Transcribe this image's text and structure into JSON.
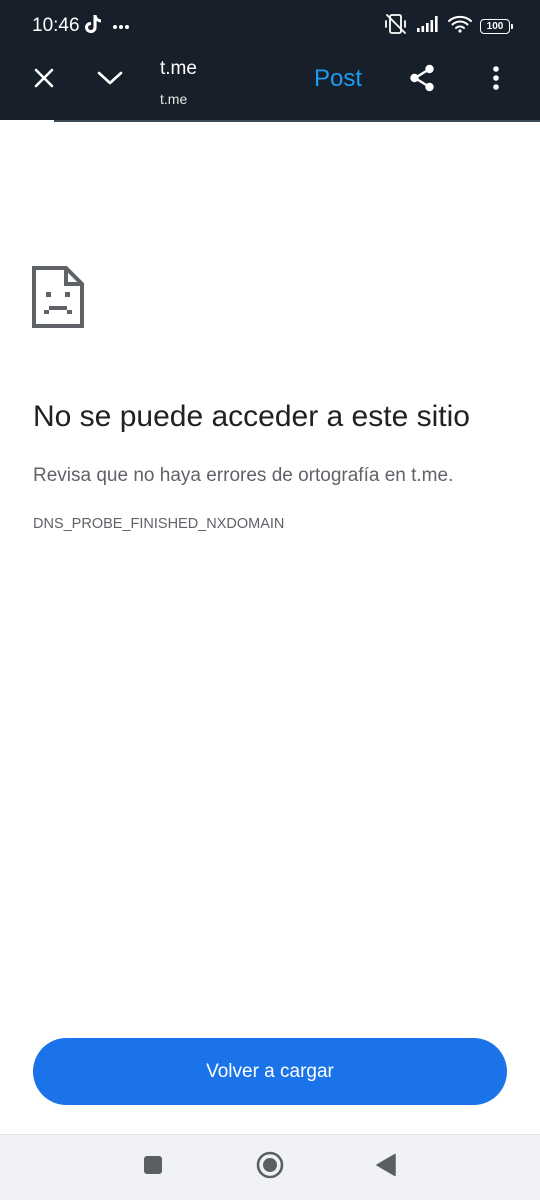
{
  "status_bar": {
    "time": "10:46",
    "battery_level": "100",
    "icons": [
      "tiktok-icon",
      "more-notifications-icon",
      "vibrate-off-icon",
      "signal-icon",
      "wifi-icon",
      "battery-icon"
    ]
  },
  "toolbar": {
    "title": "t.me",
    "subtitle": "t.me",
    "post_label": "Post",
    "accent_color": "#1d9bf0",
    "background_color": "#17202a",
    "icons": [
      "close-icon",
      "chevron-down-icon",
      "share-icon",
      "more-vert-icon"
    ]
  },
  "error": {
    "icon": "sad-page-icon",
    "title": "No se puede acceder a este sitio",
    "description": "Revisa que no haya errores de ortografía en t.me.",
    "code": "DNS_PROBE_FINISHED_NXDOMAIN"
  },
  "actions": {
    "reload_label": "Volver a cargar",
    "reload_color": "#1a73e8"
  },
  "navigation_bar": {
    "icons": [
      "recents-square-icon",
      "home-circle-icon",
      "back-triangle-icon"
    ]
  }
}
